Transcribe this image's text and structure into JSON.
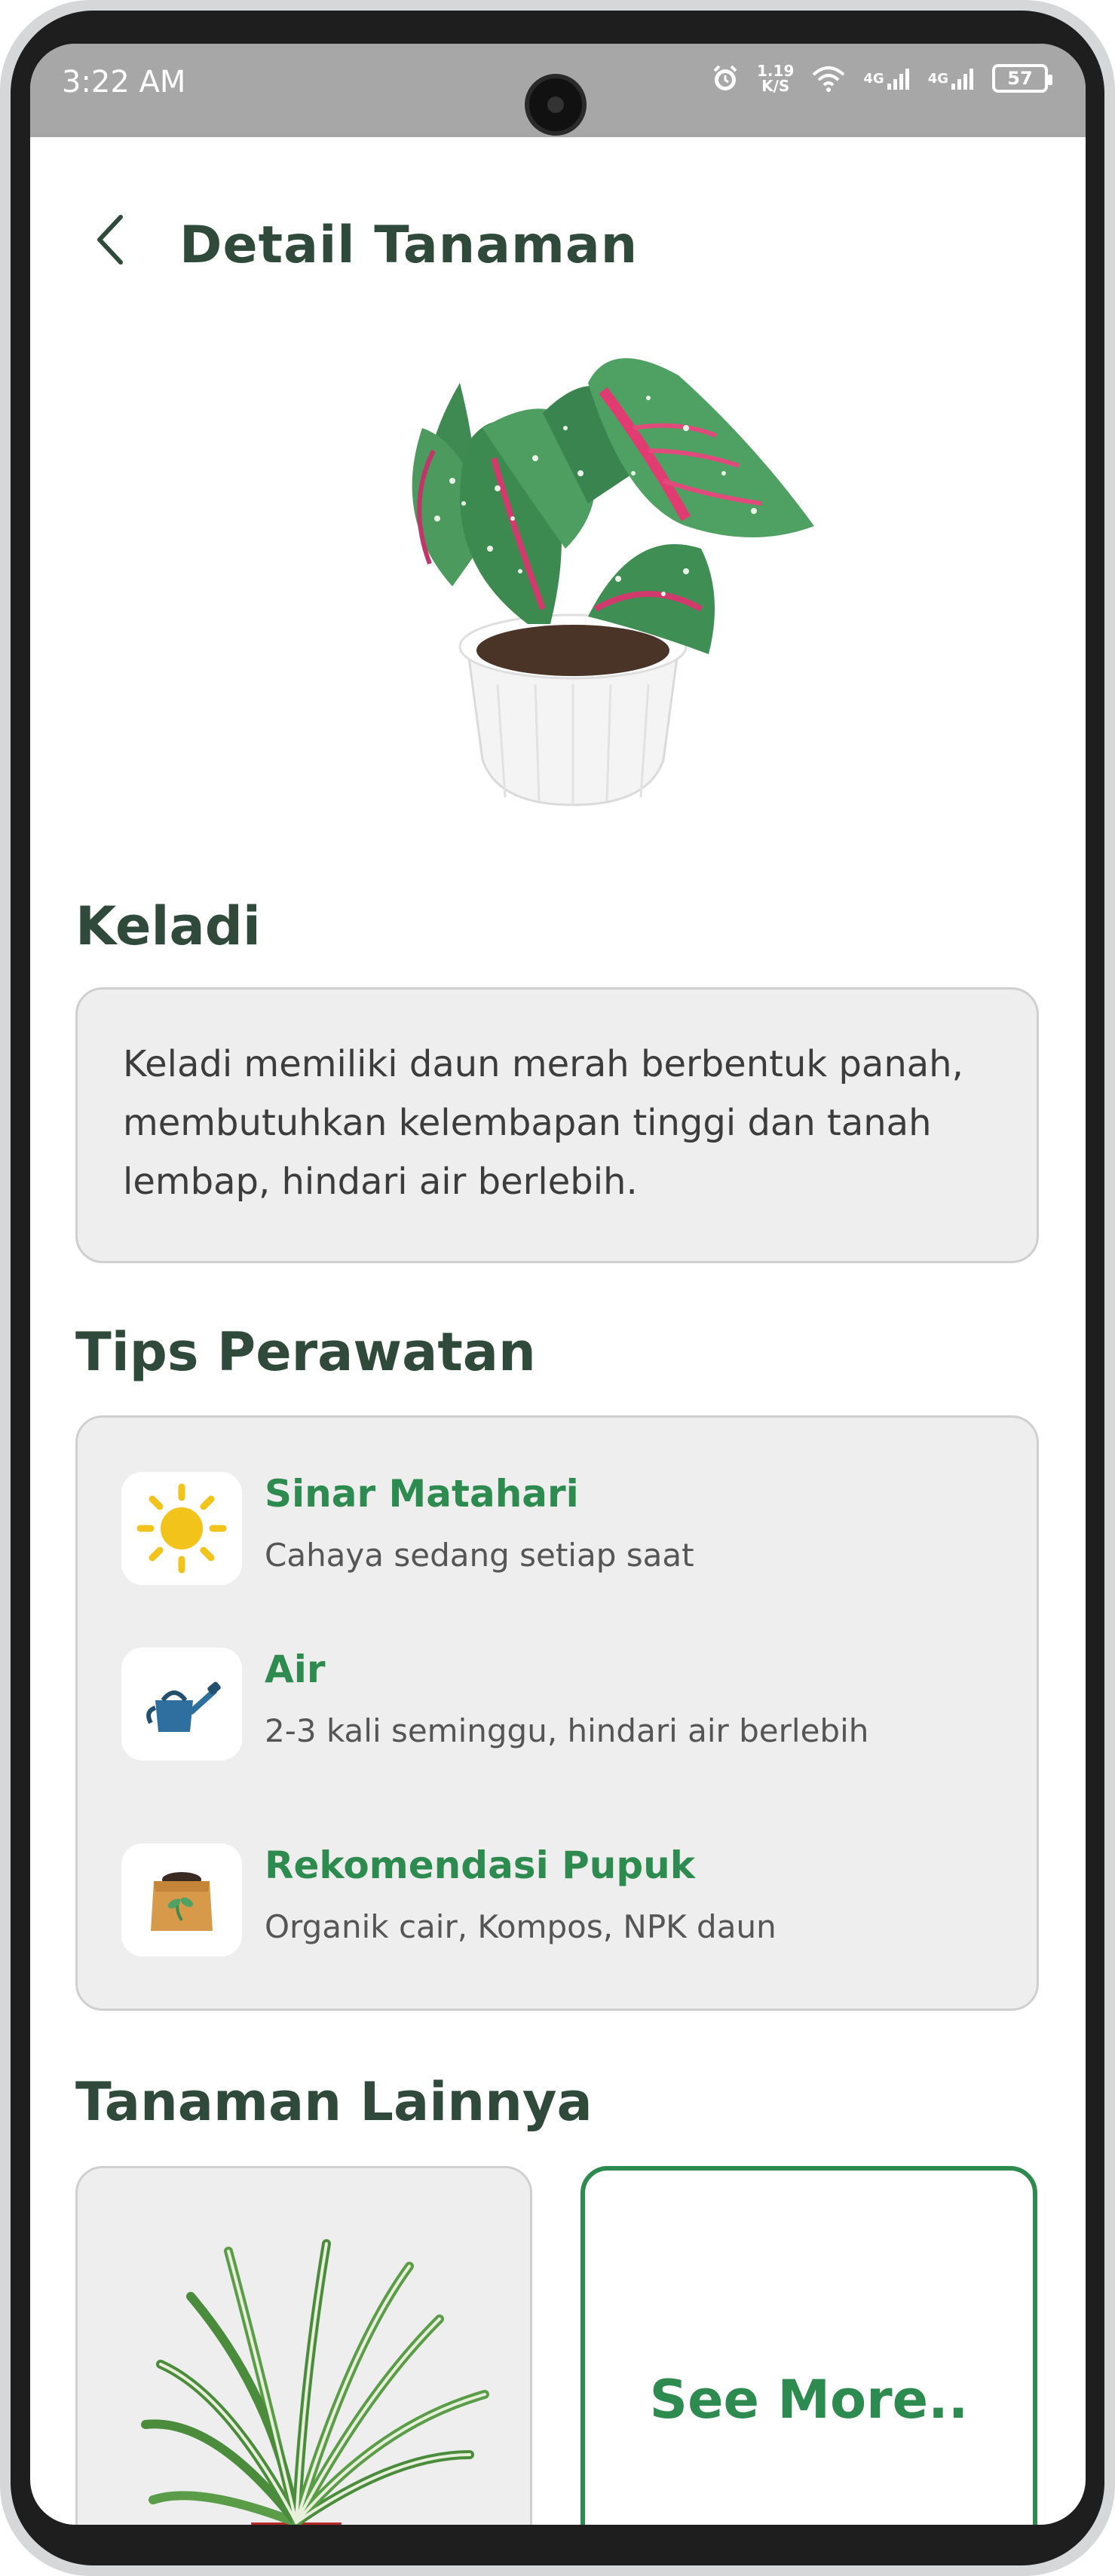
{
  "status_bar": {
    "time": "3:22 AM",
    "net_speed_value": "1.19",
    "net_speed_unit": "K/S",
    "signal1_label": "4G",
    "signal2_label": "4G",
    "battery": "57"
  },
  "header": {
    "title": "Detail Tanaman",
    "back_icon": "chevron-left-icon"
  },
  "plant": {
    "name": "Keladi",
    "description": "Keladi memiliki daun merah berbentuk panah, membutuhkan kelembapan tinggi dan tanah lembap, hindari air berlebih."
  },
  "tips": {
    "section_title": "Tips Perawatan",
    "items": [
      {
        "icon": "sun-icon",
        "title": "Sinar Matahari",
        "subtitle": "Cahaya sedang setiap saat"
      },
      {
        "icon": "watering-can-icon",
        "title": "Air",
        "subtitle": "2-3 kali seminggu, hindari air berlebih"
      },
      {
        "icon": "fertilizer-bag-icon",
        "title": "Rekomendasi Pupuk",
        "subtitle": "Organik cair, Kompos, NPK daun"
      }
    ]
  },
  "others": {
    "section_title": "Tanaman Lainnya",
    "see_more_label": "See More.."
  },
  "colors": {
    "title_text": "#2f4a3a",
    "accent_green": "#2e8b4f",
    "card_bg": "#eeeeee",
    "status_bar_bg": "#a7a7a7"
  }
}
